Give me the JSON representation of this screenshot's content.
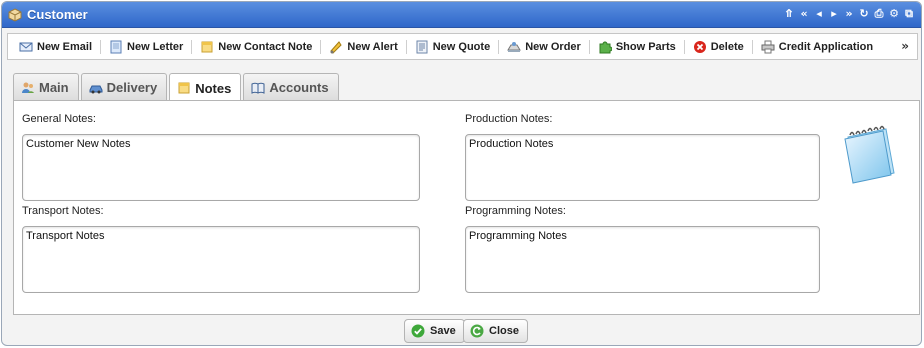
{
  "window": {
    "title": "Customer",
    "controls": [
      "⤊",
      "«",
      "◂",
      "▸",
      "»",
      "↻",
      "⎙",
      "⚙",
      "⧉"
    ]
  },
  "toolbar": {
    "items": [
      {
        "label": "New Email",
        "icon": "envelope-icon"
      },
      {
        "label": "New Letter",
        "icon": "letter-icon"
      },
      {
        "label": "New Contact Note",
        "icon": "note-icon"
      },
      {
        "label": "New Alert",
        "icon": "alert-icon"
      },
      {
        "label": "New Quote",
        "icon": "quote-icon"
      },
      {
        "label": "New Order",
        "icon": "order-icon"
      },
      {
        "label": "Show Parts",
        "icon": "puzzle-icon"
      },
      {
        "label": "Delete",
        "icon": "delete-icon"
      },
      {
        "label": "Credit Application",
        "icon": "printer-icon"
      }
    ],
    "more": "»"
  },
  "tabs": [
    {
      "label": "Main",
      "icon": "users-icon",
      "active": false
    },
    {
      "label": "Delivery",
      "icon": "car-icon",
      "active": false
    },
    {
      "label": "Notes",
      "icon": "notes-icon",
      "active": true
    },
    {
      "label": "Accounts",
      "icon": "book-icon",
      "active": false
    }
  ],
  "notes": {
    "general_label": "General Notes:",
    "general_value": "Customer New Notes",
    "production_label": "Production Notes:",
    "production_value": "Production Notes",
    "transport_label": "Transport Notes:",
    "transport_value": "Transport Notes",
    "programming_label": "Programming Notes:",
    "programming_value": "Programming Notes"
  },
  "footer": {
    "save_label": "Save",
    "close_label": "Close"
  },
  "colors": {
    "titlebar": "#3a74d4",
    "delete_red": "#d9261c",
    "save_green": "#3ea83a"
  }
}
